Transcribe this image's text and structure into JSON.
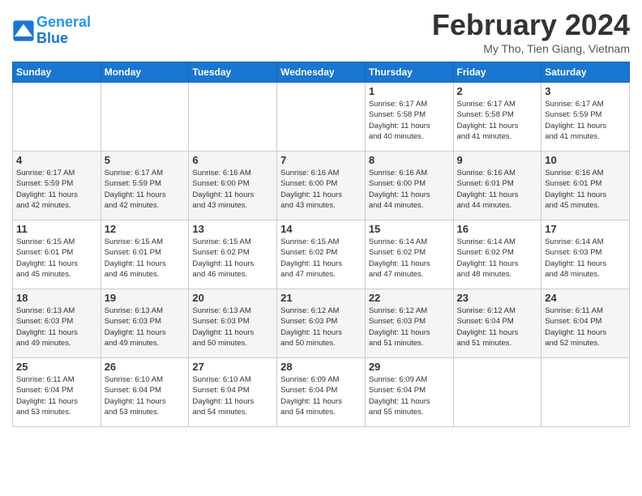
{
  "header": {
    "logo_line1": "General",
    "logo_line2": "Blue",
    "title": "February 2024",
    "subtitle": "My Tho, Tien Giang, Vietnam"
  },
  "days_of_week": [
    "Sunday",
    "Monday",
    "Tuesday",
    "Wednesday",
    "Thursday",
    "Friday",
    "Saturday"
  ],
  "weeks": [
    [
      {
        "day": "",
        "info": ""
      },
      {
        "day": "",
        "info": ""
      },
      {
        "day": "",
        "info": ""
      },
      {
        "day": "",
        "info": ""
      },
      {
        "day": "1",
        "info": "Sunrise: 6:17 AM\nSunset: 5:58 PM\nDaylight: 11 hours\nand 40 minutes."
      },
      {
        "day": "2",
        "info": "Sunrise: 6:17 AM\nSunset: 5:58 PM\nDaylight: 11 hours\nand 41 minutes."
      },
      {
        "day": "3",
        "info": "Sunrise: 6:17 AM\nSunset: 5:59 PM\nDaylight: 11 hours\nand 41 minutes."
      }
    ],
    [
      {
        "day": "4",
        "info": "Sunrise: 6:17 AM\nSunset: 5:59 PM\nDaylight: 11 hours\nand 42 minutes."
      },
      {
        "day": "5",
        "info": "Sunrise: 6:17 AM\nSunset: 5:59 PM\nDaylight: 11 hours\nand 42 minutes."
      },
      {
        "day": "6",
        "info": "Sunrise: 6:16 AM\nSunset: 6:00 PM\nDaylight: 11 hours\nand 43 minutes."
      },
      {
        "day": "7",
        "info": "Sunrise: 6:16 AM\nSunset: 6:00 PM\nDaylight: 11 hours\nand 43 minutes."
      },
      {
        "day": "8",
        "info": "Sunrise: 6:16 AM\nSunset: 6:00 PM\nDaylight: 11 hours\nand 44 minutes."
      },
      {
        "day": "9",
        "info": "Sunrise: 6:16 AM\nSunset: 6:01 PM\nDaylight: 11 hours\nand 44 minutes."
      },
      {
        "day": "10",
        "info": "Sunrise: 6:16 AM\nSunset: 6:01 PM\nDaylight: 11 hours\nand 45 minutes."
      }
    ],
    [
      {
        "day": "11",
        "info": "Sunrise: 6:15 AM\nSunset: 6:01 PM\nDaylight: 11 hours\nand 45 minutes."
      },
      {
        "day": "12",
        "info": "Sunrise: 6:15 AM\nSunset: 6:01 PM\nDaylight: 11 hours\nand 46 minutes."
      },
      {
        "day": "13",
        "info": "Sunrise: 6:15 AM\nSunset: 6:02 PM\nDaylight: 11 hours\nand 46 minutes."
      },
      {
        "day": "14",
        "info": "Sunrise: 6:15 AM\nSunset: 6:02 PM\nDaylight: 11 hours\nand 47 minutes."
      },
      {
        "day": "15",
        "info": "Sunrise: 6:14 AM\nSunset: 6:02 PM\nDaylight: 11 hours\nand 47 minutes."
      },
      {
        "day": "16",
        "info": "Sunrise: 6:14 AM\nSunset: 6:02 PM\nDaylight: 11 hours\nand 48 minutes."
      },
      {
        "day": "17",
        "info": "Sunrise: 6:14 AM\nSunset: 6:03 PM\nDaylight: 11 hours\nand 48 minutes."
      }
    ],
    [
      {
        "day": "18",
        "info": "Sunrise: 6:13 AM\nSunset: 6:03 PM\nDaylight: 11 hours\nand 49 minutes."
      },
      {
        "day": "19",
        "info": "Sunrise: 6:13 AM\nSunset: 6:03 PM\nDaylight: 11 hours\nand 49 minutes."
      },
      {
        "day": "20",
        "info": "Sunrise: 6:13 AM\nSunset: 6:03 PM\nDaylight: 11 hours\nand 50 minutes."
      },
      {
        "day": "21",
        "info": "Sunrise: 6:12 AM\nSunset: 6:03 PM\nDaylight: 11 hours\nand 50 minutes."
      },
      {
        "day": "22",
        "info": "Sunrise: 6:12 AM\nSunset: 6:03 PM\nDaylight: 11 hours\nand 51 minutes."
      },
      {
        "day": "23",
        "info": "Sunrise: 6:12 AM\nSunset: 6:04 PM\nDaylight: 11 hours\nand 51 minutes."
      },
      {
        "day": "24",
        "info": "Sunrise: 6:11 AM\nSunset: 6:04 PM\nDaylight: 11 hours\nand 52 minutes."
      }
    ],
    [
      {
        "day": "25",
        "info": "Sunrise: 6:11 AM\nSunset: 6:04 PM\nDaylight: 11 hours\nand 53 minutes."
      },
      {
        "day": "26",
        "info": "Sunrise: 6:10 AM\nSunset: 6:04 PM\nDaylight: 11 hours\nand 53 minutes."
      },
      {
        "day": "27",
        "info": "Sunrise: 6:10 AM\nSunset: 6:04 PM\nDaylight: 11 hours\nand 54 minutes."
      },
      {
        "day": "28",
        "info": "Sunrise: 6:09 AM\nSunset: 6:04 PM\nDaylight: 11 hours\nand 54 minutes."
      },
      {
        "day": "29",
        "info": "Sunrise: 6:09 AM\nSunset: 6:04 PM\nDaylight: 11 hours\nand 55 minutes."
      },
      {
        "day": "",
        "info": ""
      },
      {
        "day": "",
        "info": ""
      }
    ]
  ]
}
